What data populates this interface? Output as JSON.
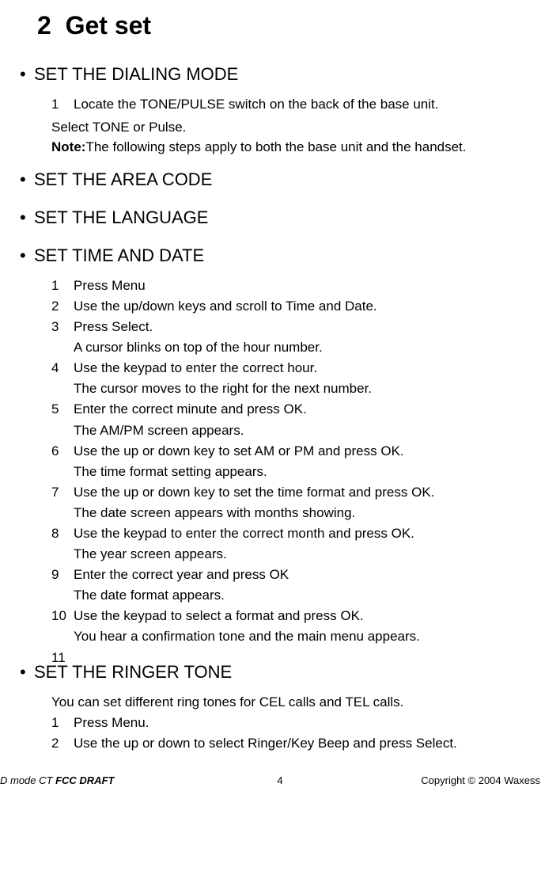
{
  "chapter": {
    "number": "2",
    "title": "Get set"
  },
  "sections": {
    "dialing": {
      "heading": "SET THE DIALING MODE",
      "step1": "Locate the TONE/PULSE switch on the back of the base unit.",
      "line2": "Select TONE or Pulse.",
      "noteLabel": "Note:",
      "noteText": "The following steps apply to both the base unit and the handset."
    },
    "area": {
      "heading": "SET THE AREA CODE"
    },
    "lang": {
      "heading": "SET THE LANGUAGE"
    },
    "time": {
      "heading": "SET TIME AND DATE",
      "s1": "Press Menu",
      "s2": "Use the up/down keys and scroll to Time and Date.",
      "s3": "Press Select.",
      "s3b": "A cursor blinks on top of the hour number.",
      "s4": "Use the keypad to enter the correct hour.",
      "s4b": "The cursor moves to the right for the next number.",
      "s5": "Enter the correct minute and press OK.",
      "s5b": "The AM/PM screen appears.",
      "s6": "Use the up or down key to set AM or PM and press OK.",
      "s6b": "The time format setting appears.",
      "s7": "Use the up or down key to set the time format and press OK.",
      "s7b": "The date screen appears with months showing.",
      "s8": "Use the keypad to enter the correct month and press OK.",
      "s8b": "The year screen appears.",
      "s9": "Enter the correct year and press OK",
      "s9b": "The date format appears.",
      "s10": "Use the keypad to select a format and press OK.",
      "s10b": "You hear a confirmation tone and the main menu appears.",
      "s11": ""
    },
    "ringer": {
      "heading": "SET THE RINGER TONE",
      "intro": "You can set different ring tones for CEL calls and TEL calls.",
      "s1": "Press Menu.",
      "s2": "Use the up or down to select Ringer/Key Beep and press Select."
    }
  },
  "footer": {
    "leftPlain": "D mode CT ",
    "leftBold": "FCC DRAFT",
    "page": "4",
    "right": "Copyright © 2004 Waxess"
  }
}
